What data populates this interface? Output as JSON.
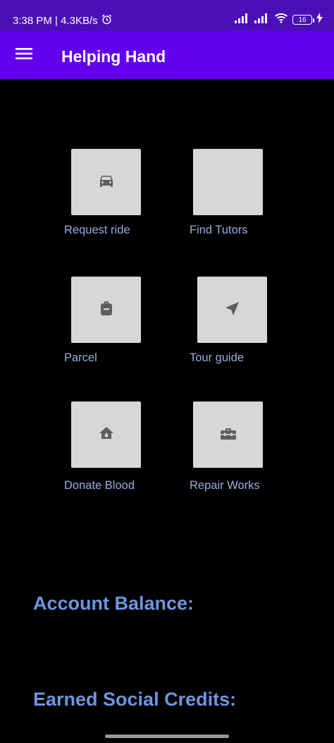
{
  "status_bar": {
    "time_speed": "3:38 PM | 4.3KB/s",
    "battery": "16"
  },
  "app_bar": {
    "title": "Helping Hand"
  },
  "services": [
    {
      "label": "Request ride",
      "icon": "car-icon"
    },
    {
      "label": "Find Tutors",
      "icon": ""
    },
    {
      "label": "Parcel",
      "icon": "backpack-icon"
    },
    {
      "label": "Tour guide",
      "icon": "navigation-arrow-icon"
    },
    {
      "label": "Donate Blood",
      "icon": "home-drop-icon"
    },
    {
      "label": "Repair Works",
      "icon": "toolbox-icon"
    }
  ],
  "account": {
    "balance_label": "Account Balance:",
    "credits_label": "Earned Social Credits:"
  },
  "colors": {
    "status_bar": "#4a0fb7",
    "app_bar": "#6200ee",
    "tile": "#d6d7d6",
    "label": "#94aedf",
    "heading": "#6f95de",
    "icon": "#5e5e5e"
  }
}
